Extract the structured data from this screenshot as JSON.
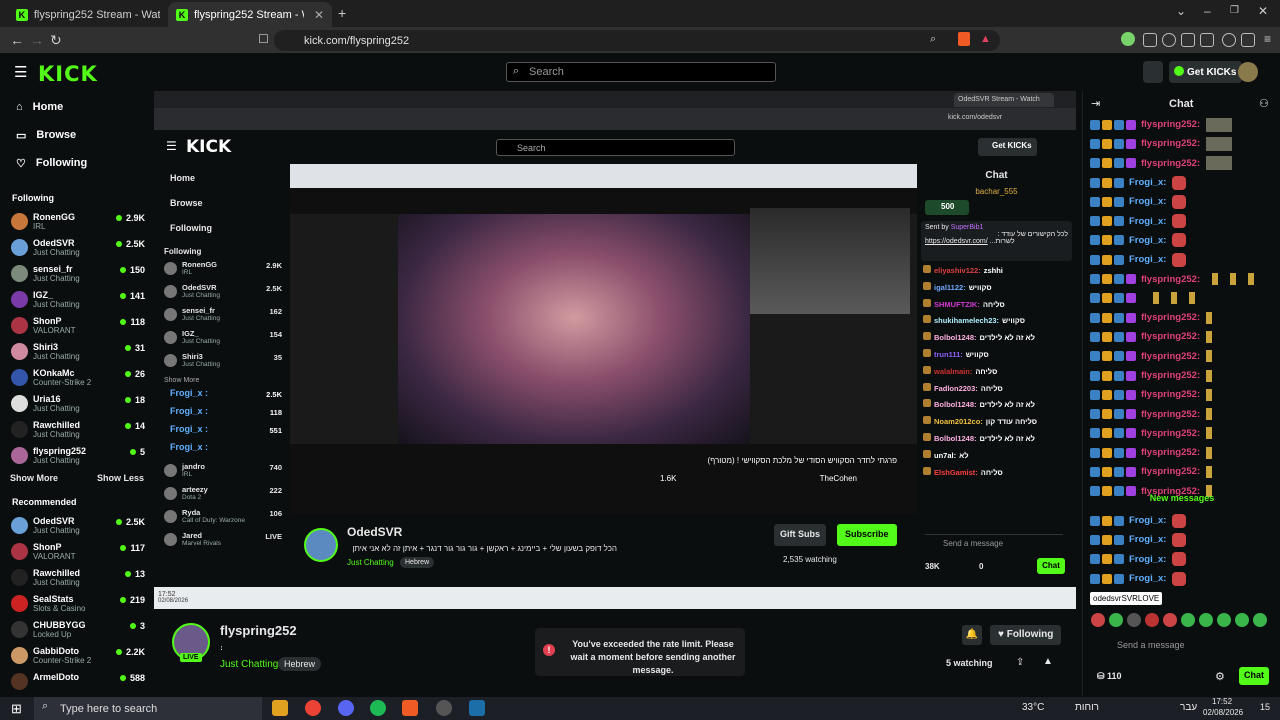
{
  "browser": {
    "tabs": [
      {
        "label": "flyspring252 Stream - Watch Live on",
        "active": false
      },
      {
        "label": "flyspring252 Stream - Watch",
        "active": true
      }
    ],
    "url": "kick.com/flyspring252"
  },
  "header": {
    "logo": "KICK",
    "search_placeholder": "Search",
    "get_kicks": "Get KICKs"
  },
  "sidebar": {
    "nav": [
      {
        "label": "Home",
        "icon": "home-icon"
      },
      {
        "label": "Browse",
        "icon": "browse-icon"
      },
      {
        "label": "Following",
        "icon": "heart-icon"
      }
    ],
    "following_title": "Following",
    "following": [
      {
        "name": "RonenGG",
        "cat": "IRL",
        "viewers": "2.9K",
        "color": "#c8763a"
      },
      {
        "name": "OdedSVR",
        "cat": "Just Chatting",
        "viewers": "2.5K",
        "color": "#6aa0d8"
      },
      {
        "name": "sensei_fr",
        "cat": "Just Chatting",
        "viewers": "150",
        "color": "#7b8a7a"
      },
      {
        "name": "IGZ_",
        "cat": "Just Chatting",
        "viewers": "141",
        "color": "#7a3aa8"
      },
      {
        "name": "ShonP",
        "cat": "VALORANT",
        "viewers": "118",
        "color": "#aa3344"
      },
      {
        "name": "Shiri3",
        "cat": "Just Chatting",
        "viewers": "31",
        "color": "#d08aa0"
      },
      {
        "name": "KOnkaMc",
        "cat": "Counter-Strike 2",
        "viewers": "26",
        "color": "#3355aa"
      },
      {
        "name": "Uria16",
        "cat": "Just Chatting",
        "viewers": "18",
        "color": "#dddddd"
      },
      {
        "name": "Rawchilled",
        "cat": "Just Chatting",
        "viewers": "14",
        "color": "#222222"
      },
      {
        "name": "flyspring252",
        "cat": "Just Chatting",
        "viewers": "5",
        "color": "#aa6699"
      }
    ],
    "show_more": "Show More",
    "show_less": "Show Less",
    "recommended_title": "Recommended",
    "recommended": [
      {
        "name": "OdedSVR",
        "cat": "Just Chatting",
        "viewers": "2.5K",
        "color": "#6aa0d8"
      },
      {
        "name": "ShonP",
        "cat": "VALORANT",
        "viewers": "117",
        "color": "#aa3344"
      },
      {
        "name": "Rawchilled",
        "cat": "Just Chatting",
        "viewers": "13",
        "color": "#222222"
      },
      {
        "name": "SealStats",
        "cat": "Slots & Casino",
        "viewers": "219",
        "color": "#cc2222"
      },
      {
        "name": "CHUBBYGG",
        "cat": "Locked Up",
        "viewers": "3",
        "color": "#333333"
      },
      {
        "name": "GabbiDoto",
        "cat": "Counter-Strike 2",
        "viewers": "2.2K",
        "color": "#cc9966"
      },
      {
        "name": "ArmelDoto",
        "cat": "",
        "viewers": "588",
        "color": "#553322"
      }
    ]
  },
  "embed": {
    "search_placeholder": "Search",
    "get_kicks": "Get KICKs",
    "nav": [
      "Home",
      "Browse",
      "Following"
    ],
    "following_title": "Following",
    "following": [
      {
        "name": "RonenGG",
        "cat": "IRL",
        "viewers": "2.9K"
      },
      {
        "name": "OdedSVR",
        "cat": "Just Chatting",
        "viewers": "2.5K"
      },
      {
        "name": "sensei_fr",
        "cat": "Just Chatting",
        "viewers": "162"
      },
      {
        "name": "IGZ_",
        "cat": "Just Chatting",
        "viewers": "154"
      },
      {
        "name": "Shiri3",
        "cat": "Just Chatting",
        "viewers": "35"
      }
    ],
    "show_more": "Show More",
    "overlay_names": [
      "Frogi_x :",
      "Frogi_x :",
      "Frogi_x :",
      "Frogi_x :"
    ],
    "more_channels": [
      {
        "name": "jandro",
        "cat": "IRL",
        "viewers": "740"
      },
      {
        "name": "arteezy",
        "cat": "Dota 2",
        "viewers": "222"
      },
      {
        "name": "Ryda",
        "cat": "Call of Duty: Warzone",
        "viewers": "106"
      },
      {
        "name": "Jared",
        "cat": "Marvel Rivals",
        "viewers": "LIVE"
      }
    ],
    "extra_viewers": [
      "2.5K",
      "118",
      "551"
    ],
    "streamer": "OdedSVR",
    "stream_title": "הכל דופק בשעון שלי + ביימינג + ראקשן + גור גור גור דנגר + איתן זה לא אני איתן",
    "category": "Just Chatting",
    "tag": "Hebrew",
    "gift_subs": "Gift Subs",
    "subscribe": "Subscribe",
    "watching": "2,535 watching",
    "video_caption": "פרגתי לחדר הסקוויש הסודי של מלכת הסקווישי ! (מטורף)",
    "video_channel": "TheCohen",
    "likes": "1.6K",
    "chat_title": "Chat",
    "chat_top_user": "bachar_555",
    "chat_badge": "500",
    "pinned_by": "Sent by",
    "pinned_user": "SuperBib1",
    "pinned_text": "לכל הקישורים של עודד :",
    "pinned_link": "https://odedsvr.com/",
    "pinned_tail": "...לשרות",
    "chat_lines": [
      {
        "u": "eliyashiv122:",
        "t": "zshhi",
        "c": "#e04040"
      },
      {
        "u": "igal1122:",
        "t": "סקוויש",
        "c": "#6fa8ff"
      },
      {
        "u": "SHMUFTZIK:",
        "t": "סליחה",
        "c": "#d03ad0"
      },
      {
        "u": "shukihamelech23:",
        "t": "סקוויש",
        "c": "#b0f0ff"
      },
      {
        "u": "Bolbol1248:",
        "t": "לא זה לא לילדים",
        "c": "#ffb0e0"
      },
      {
        "u": "trun111:",
        "t": "סקוויש",
        "c": "#9060ff"
      },
      {
        "u": "walalmain:",
        "t": "סליחה",
        "c": "#d03030"
      },
      {
        "u": "Fadlon2203:",
        "t": "סליחה",
        "c": "#ffb0e0"
      },
      {
        "u": "Bolbol1248:",
        "t": "לא זה לא לילדים",
        "c": "#ffb0e0"
      },
      {
        "u": "Noam2012co:",
        "t": "סליחה עודד קון",
        "c": "#f0c040"
      },
      {
        "u": "Bolbol1248:",
        "t": "לא זה לא לילדים",
        "c": "#ffb0e0"
      },
      {
        "u": "un7al:",
        "t": "לא",
        "c": "#ffffff"
      },
      {
        "u": "ElshGamist:",
        "t": "סליחה",
        "c": "#ff4040"
      }
    ],
    "send_placeholder": "Send a message",
    "kicks_count": "38K",
    "zero": "0",
    "chat_button": "Chat",
    "time": "17:52",
    "date": "02/08/2026"
  },
  "stream": {
    "channel": "flyspring252",
    "title": "։",
    "category": "Just Chatting",
    "tag": "Hebrew",
    "following_btn": "Following",
    "watching": "5 watching",
    "live_badge": "LIVE",
    "toast": "You've exceeded the rate limit. Please wait a moment before sending another message."
  },
  "chat": {
    "title": "Chat",
    "rows": [
      {
        "user": "flyspring252:",
        "color": "#e0407a",
        "extra": "img"
      },
      {
        "user": "flyspring252:",
        "color": "#e0407a",
        "extra": "img"
      },
      {
        "user": "flyspring252:",
        "color": "#e0407a",
        "extra": "img"
      },
      {
        "user": "Frogi_x:",
        "color": "#5fb0ff",
        "extra": "emote"
      },
      {
        "user": "Frogi_x:",
        "color": "#5fb0ff",
        "extra": "emote"
      },
      {
        "user": "Frogi_x:",
        "color": "#5fb0ff",
        "extra": "emote"
      },
      {
        "user": "Frogi_x:",
        "color": "#5fb0ff",
        "extra": "emote"
      },
      {
        "user": "Frogi_x:",
        "color": "#5fb0ff",
        "extra": "emote"
      },
      {
        "user": "flyspring252:",
        "color": "#e0407a",
        "extra": "gold3"
      },
      {
        "user": "",
        "color": "#e0407a",
        "extra": "gold3"
      },
      {
        "user": "flyspring252:",
        "color": "#e0407a",
        "extra": "gold"
      },
      {
        "user": "flyspring252:",
        "color": "#e0407a",
        "extra": "gold"
      },
      {
        "user": "flyspring252:",
        "color": "#e0407a",
        "extra": "gold"
      },
      {
        "user": "flyspring252:",
        "color": "#e0407a",
        "extra": "gold"
      },
      {
        "user": "flyspring252:",
        "color": "#e0407a",
        "extra": "gold"
      },
      {
        "user": "flyspring252:",
        "color": "#e0407a",
        "extra": "gold"
      },
      {
        "user": "flyspring252:",
        "color": "#e0407a",
        "extra": "gold"
      },
      {
        "user": "flyspring252:",
        "color": "#e0407a",
        "extra": "gold"
      },
      {
        "user": "flyspring252:",
        "color": "#e0407a",
        "extra": "gold"
      },
      {
        "user": "flyspring252:",
        "color": "#e0407a",
        "extra": "gold"
      }
    ],
    "new_messages": "New messages",
    "after_rows": [
      {
        "user": "Frogi_x:",
        "color": "#5fb0ff"
      },
      {
        "user": "Frogi_x:",
        "color": "#5fb0ff"
      },
      {
        "user": "Frogi_x:",
        "color": "#5fb0ff"
      },
      {
        "user": "Frogi_x:",
        "color": "#5fb0ff"
      }
    ],
    "tooltip": "odedsvrSVRLOVE",
    "send_placeholder": "Send a message",
    "kicks": "110",
    "chat_button": "Chat"
  },
  "taskbar": {
    "search_placeholder": "Type here to search",
    "weather": "33°C",
    "weather_label": "רוחות",
    "lang": "עבר",
    "time": "17:52",
    "date": "02/08/2026",
    "notif": "15"
  },
  "colors": {
    "brand": "#53fc18",
    "bg": "#0b0e0f"
  }
}
